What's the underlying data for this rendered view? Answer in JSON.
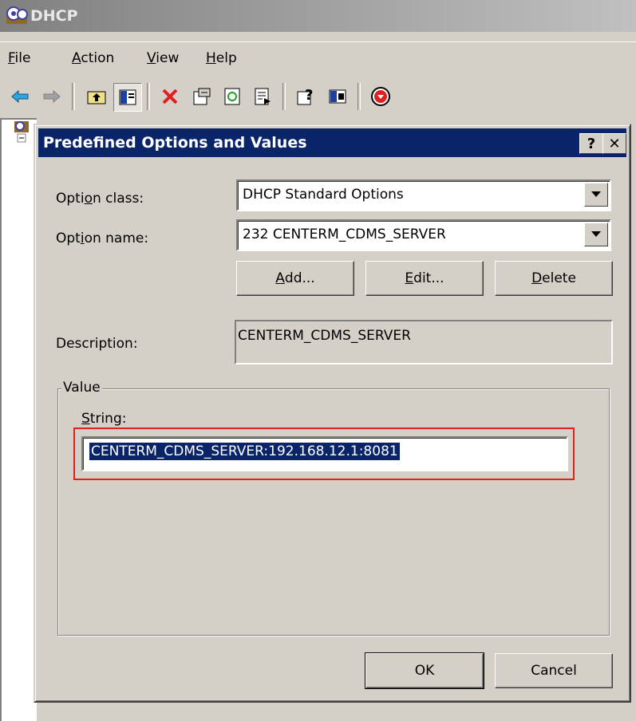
{
  "window": {
    "title": "DHCP"
  },
  "menu": [
    {
      "pre": "",
      "key": "F",
      "post": "ile"
    },
    {
      "pre": "",
      "key": "A",
      "post": "ction"
    },
    {
      "pre": "",
      "key": "V",
      "post": "iew"
    },
    {
      "pre": "",
      "key": "H",
      "post": "elp"
    }
  ],
  "toolbar": {
    "icons": [
      "back-arrow-icon",
      "forward-arrow-icon",
      "up-folder-icon",
      "show-hide-tree-icon",
      "delete-icon",
      "properties-icon",
      "refresh-icon",
      "export-list-icon",
      "help-icon",
      "console-icon",
      "stop-service-icon"
    ]
  },
  "dialog": {
    "title": "Predefined Options and Values",
    "help_button": "?",
    "close_button": "✕",
    "option_class_label": {
      "pre": "Opti",
      "key": "o",
      "post": "n class:"
    },
    "option_class_value": "DHCP Standard Options",
    "option_name_label": {
      "pre": "Opt",
      "key": "i",
      "post": "on name:"
    },
    "option_name_value": "232 CENTERM_CDMS_SERVER",
    "add_button": {
      "pre": "",
      "key": "A",
      "post": "dd..."
    },
    "edit_button": {
      "pre": "",
      "key": "E",
      "post": "dit..."
    },
    "delete_button": {
      "pre": "",
      "key": "D",
      "post": "elete"
    },
    "description_label": "Description:",
    "description_value": "CENTERM_CDMS_SERVER",
    "value_group_label": "Value",
    "string_label": {
      "pre": "",
      "key": "S",
      "post": "tring:"
    },
    "string_value": "CENTERM_CDMS_SERVER:192.168.12.1:8081",
    "ok_button": "OK",
    "cancel_button": "Cancel"
  },
  "colors": {
    "title_active": "#0a246a",
    "face": "#d4d0c8",
    "highlight_box": "#e0201c"
  }
}
